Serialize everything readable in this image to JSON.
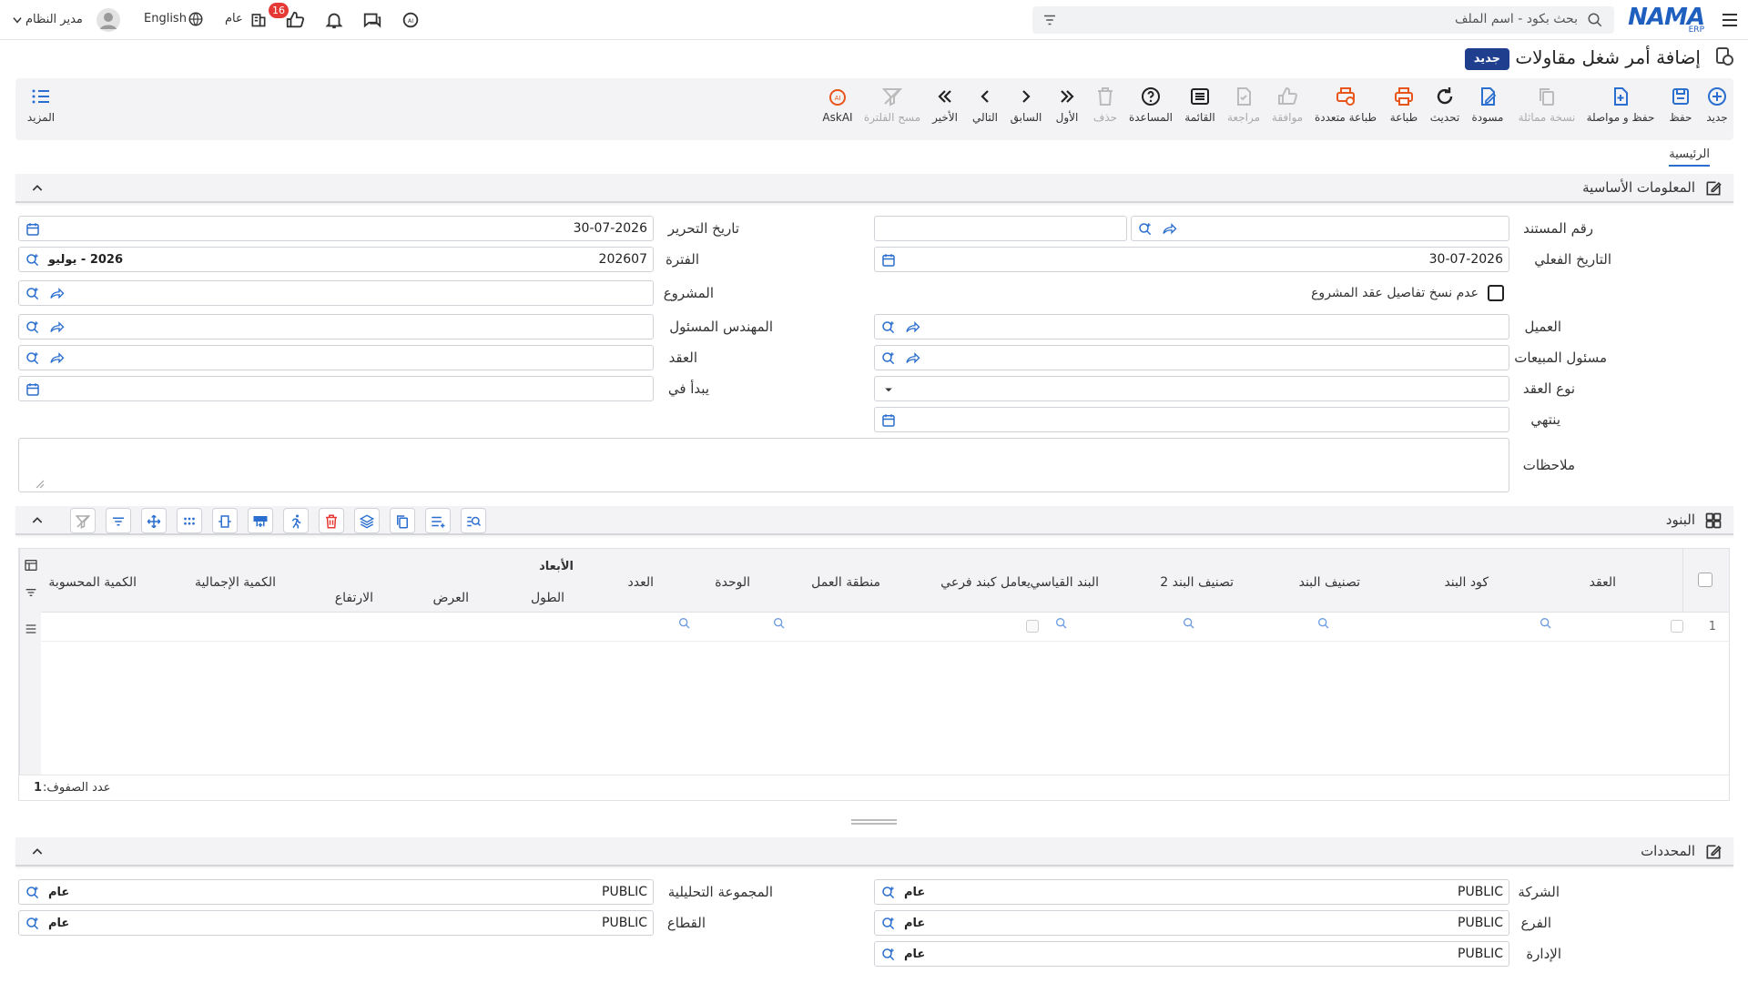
{
  "app": {
    "logo": "NAMA",
    "logo_sub": "ERP",
    "search_placeholder": "بحث بكود - اسم الملف",
    "user_name": "مدير النظام",
    "language": "English",
    "branch_label": "عام",
    "notification_count": "16"
  },
  "page": {
    "title": "إضافة أمر شغل مقاولات",
    "badge": "جديد"
  },
  "toolbar": {
    "new": "جديد",
    "save": "حفظ",
    "save_continue": "حفظ و مواصلة",
    "duplicate": "نسخة مماثلة",
    "draft": "مسودة",
    "refresh": "تحديث",
    "print": "طباعة",
    "multi_print": "طباعة متعددة",
    "approve": "موافقة",
    "review": "مراجعة",
    "list": "القائمة",
    "help": "المساعدة",
    "delete": "حذف",
    "first": "الأول",
    "previous": "السابق",
    "next": "التالي",
    "last": "الأخير",
    "clear_filter": "مسح الفلترة",
    "askai": "AskAI",
    "more": "المزيد"
  },
  "tabs": {
    "main": "الرئيسية"
  },
  "basic": {
    "title": "المعلومات الأساسية",
    "doc_number_label": "رقم المستند",
    "doc_number_value": "",
    "edit_date_label": "تاريخ التحرير",
    "edit_date_value": "30-07-2026",
    "actual_date_label": "التاريخ الفعلي",
    "actual_date_value": "30-07-2026",
    "period_label": "الفترة",
    "period_value": "202607",
    "period_desc": "2026 - يوليو",
    "no_copy_label": "عدم نسخ تفاصيل عقد المشروع",
    "project_label": "المشروع",
    "customer_label": "العميل",
    "engineer_label": "المهندس المسئول",
    "sales_label": "مسئول المبيعات",
    "contract_label": "العقد",
    "contract_type_label": "نوع العقد",
    "starts_label": "يبدأ في",
    "ends_label": "ينتهي",
    "notes_label": "ملاحظات"
  },
  "items": {
    "title": "البنود",
    "columns": {
      "contract": "العقد",
      "item_code": "كود البند",
      "item_class": "تصنيف البند",
      "item_class2": "تصنيف البند 2",
      "std_item": "البند القياسي",
      "sub_item": "يعامل كبند فرعي",
      "work_zone": "منطقة العمل",
      "unit": "الوحدة",
      "count": "العدد",
      "dimensions": "الأبعاد",
      "length": "الطول",
      "width": "العرض",
      "height": "الارتفاع",
      "total_qty": "الكمية الإجمالية",
      "calc_qty": "الكمية المحسوبة"
    },
    "row_number": "1",
    "row_count_label": "عدد الصفوف:",
    "row_count_value": "1"
  },
  "dims": {
    "title": "المحددات",
    "company_label": "الشركة",
    "branch_label": "الفرع",
    "dept_label": "الإدارة",
    "analytic_label": "المجموعة التحليلية",
    "sector_label": "القطاع",
    "code_value": "PUBLIC",
    "name_value": "عام"
  },
  "colors": {
    "accent": "#2a6ecf",
    "brand": "#1f5fbf",
    "print": "#e8541a",
    "badge": "#1f3f8e"
  }
}
